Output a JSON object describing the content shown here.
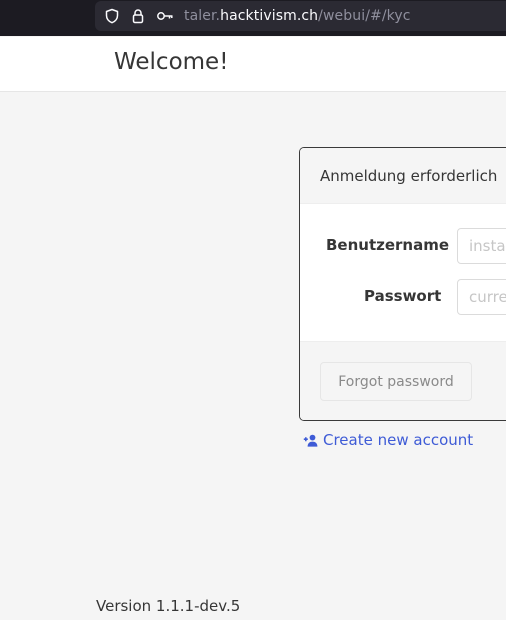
{
  "browser": {
    "url_prefix": "taler.",
    "url_domain": "hacktivism.ch",
    "url_path": "/webui/#/kyc",
    "icons": [
      "shield-icon",
      "lock-icon",
      "key-icon"
    ]
  },
  "navbar": {
    "title": "Welcome!"
  },
  "login": {
    "title": "Anmeldung erforderlich",
    "username_label": "Benutzername",
    "username_placeholder": "instance name",
    "password_label": "Passwort",
    "password_placeholder": "current password",
    "forgot_label": "Forgot password"
  },
  "links": {
    "create_account": "Create new account",
    "create_icon": "user-plus-icon"
  },
  "footer": {
    "version": "Version 1.1.1-dev.5"
  },
  "colors": {
    "link": "#3e5bd6",
    "toolbar": "#1c1b22",
    "urlbar": "#2b2a33"
  }
}
